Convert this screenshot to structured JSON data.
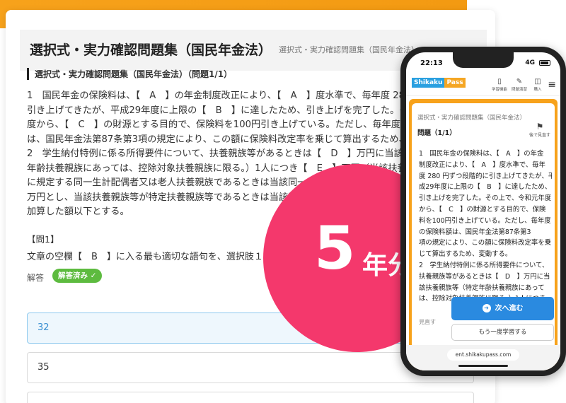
{
  "desktop": {
    "title": "選択式・実力確認問題集（国民年金法）",
    "subtitle": "選択式・実力確認問題集（国民年金法）",
    "question_heading": "選択式・実力確認問題集（国民年金法）（問題1/1）",
    "body_lines": [
      "1　国民年金の保険料は、【　A　】の年金制度改正により、【　A　】度水準で、毎年度 280円",
      "引き上げてきたが、平成29年度に上限の【　B　】に達したため、引き上げを完了した。その上",
      "度から、【　C　】の財源とする目的で、保険料を100円引き上げている。ただし、毎年度の保",
      "は、国民年金法第87条第3項の規定により、この額に保険料改定率を乗じて算出するため、変",
      "2　学生納付特例に係る所得要件について、扶養親族等があるときは【　D　】万円に当該",
      "年齢扶養親族にあっては、控除対象扶養親族に限る。）1人につき【　E　】万円（当該扶養",
      "に規定する同一生計配偶者又は老人扶養親族であるときは当該同一生計配偶者又は老人",
      "万円とし、当該扶養親族等が特定扶養親族等であるときは当該特定扶養親族等1人につき",
      "加算した額以下とする。"
    ],
    "sub_question": "【問1】",
    "instruction": "文章の空欄【　B　】に入る最も適切な語句を、選択肢１～４の中から選びなさい。",
    "answer_label": "解答",
    "answered_badge": "解答済み ✓",
    "choices": [
      "32",
      "35",
      ""
    ]
  },
  "badge": {
    "number": "5",
    "unit": "年分",
    "color": "#f4386c"
  },
  "phone": {
    "time": "22:13",
    "network": "4G",
    "logo_part1": "Shikaku",
    "logo_part2": "Pass",
    "nav": [
      {
        "icon": "book-icon",
        "glyph": "▯",
        "label": "学習機能"
      },
      {
        "icon": "pencil-icon",
        "glyph": "✎",
        "label": "問題演習"
      },
      {
        "icon": "bag-icon",
        "glyph": "◫",
        "label": "購入"
      }
    ],
    "subtitle": "選択式・実力確認問題集（国民年金法）",
    "question_title": "問題（1/1）",
    "bookmark_label": "後で見直す",
    "body_lines": [
      "1　国民年金の保険料は、【　A　】の年金",
      "制度改正により、【　A　】度水準で、毎年",
      "度 280 円ずつ段階的に引き上げてきたが、平",
      "成29年度に上限の【　B　】に達したため、",
      "引き上げを完了した。その上で、令和元年度",
      "から、【　C　】の財源とする目的で、保険",
      "料を100円引き上げている。ただし、毎年度",
      "の保険料額は、国民年金法第87条第3",
      "項の規定により、この額に保険料改定率を乗",
      "じて算出するため、変動する。",
      "2　学生納付特例に係る所得要件について、",
      "扶養親族等があるときは【　D　】万円に当",
      "該扶養親族等（特定年齢扶養親族にあって",
      "は、控除対象扶養親族に限る。）1人につき"
    ],
    "next_button": "次へ進む",
    "retry_button": "もう一度学習する",
    "url": "ent.shikakupass.com",
    "fragment": "見直す"
  }
}
